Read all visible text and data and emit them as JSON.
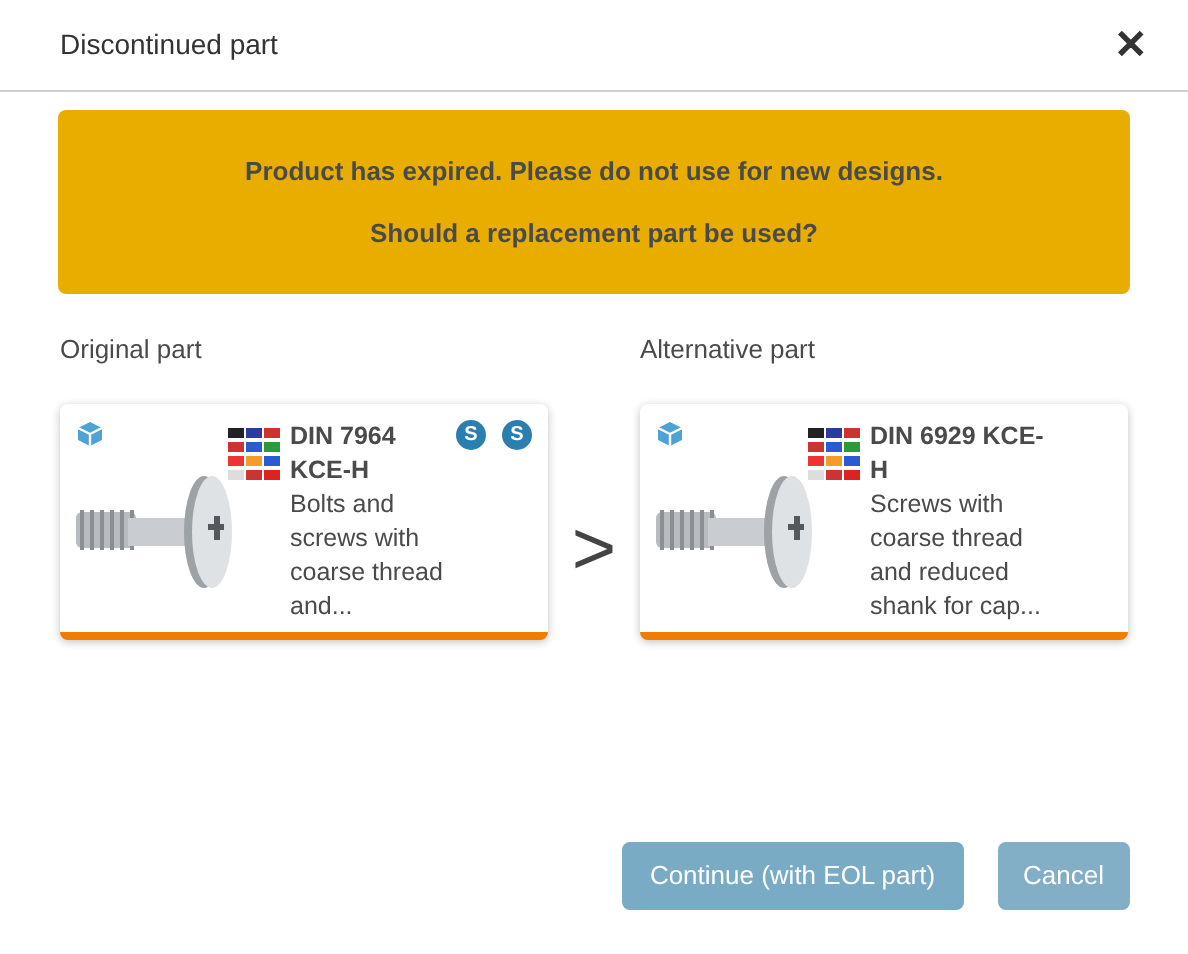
{
  "dialog": {
    "title": "Discontinued part",
    "close": "✕"
  },
  "banner": {
    "lines": [
      "Product has expired. Please do not use for new designs.",
      "Should a replacement part be used?"
    ]
  },
  "parts": [
    {
      "label": "Original part",
      "name": "DIN 7964 KCE-H",
      "description": "Bolts and screws with coarse thread and...",
      "badges": [
        "S",
        "S"
      ]
    },
    {
      "label": "Alternative part",
      "name": "DIN 6929 KCE-H",
      "description": "Screws with coarse thread and reduced shank for cap..."
    }
  ],
  "separator": ">",
  "buttons": [
    {
      "label": "Continue (with EOL part)",
      "kind": "primary"
    },
    {
      "label": "Cancel",
      "kind": "secondary"
    }
  ]
}
